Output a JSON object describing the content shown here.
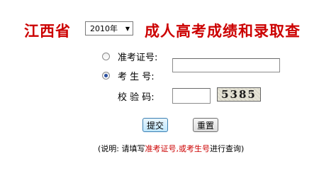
{
  "header": {
    "province": "江西省",
    "year_selected": "2010年",
    "title": "成人高考成绩和录取查"
  },
  "form": {
    "option_ticket_label": "准考证号:",
    "option_examinee_label": "考 生 号:",
    "captcha_label": "校 验 码:",
    "captcha_text": "5385",
    "selected_option": "examinee_number"
  },
  "buttons": {
    "submit": "提交",
    "reset": "重置"
  },
  "note": {
    "prefix": "(说明: 请填写",
    "highlight": "准考证号,或考生号",
    "suffix": "进行查询)"
  },
  "colors": {
    "header_red": "#cc0000",
    "radio_dot": "#2a4fa0"
  }
}
